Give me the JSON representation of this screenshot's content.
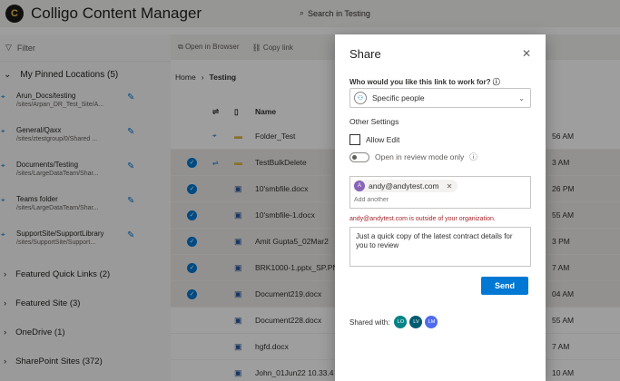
{
  "app": {
    "title": "Colligo Content Manager",
    "search": "Search in Testing"
  },
  "sidebar": {
    "filter": "Filter",
    "pinned_header": "My Pinned Locations (5)",
    "pinned": [
      {
        "title": "Arun_Docs/testing",
        "path": "/sites/Arpan_DR_Test_Site/A..."
      },
      {
        "title": "General/Qaxx",
        "path": "/sites/ztestgroup/0/Shared ..."
      },
      {
        "title": "Documents/Testing",
        "path": "/sites/LargeDataTeam/Shar..."
      },
      {
        "title": "Teams folder",
        "path": "/sites/LargeDataTeam/Shar..."
      },
      {
        "title": "SupportSite/SupportLibrary",
        "path": "/sites/SupportSite/Support..."
      }
    ],
    "groups": [
      {
        "label": "Featured Quick Links (2)"
      },
      {
        "label": "Featured Site (3)"
      },
      {
        "label": "OneDrive (1)"
      },
      {
        "label": "SharePoint Sites (372)"
      }
    ]
  },
  "toolbar": {
    "open_browser": "Open in Browser",
    "copy_link": "Copy link"
  },
  "breadcrumb": {
    "home": "Home",
    "current": "Testing"
  },
  "list": {
    "name_header": "Name",
    "rows": [
      {
        "name": "Folder_Test",
        "date": "56 AM",
        "selected": false
      },
      {
        "name": "TestBulkDelete",
        "date": "3 AM",
        "selected": true
      },
      {
        "name": "10'smbfile.docx",
        "date": "26 PM",
        "selected": true
      },
      {
        "name": "10'smbfile-1.docx",
        "date": "55 AM",
        "selected": true
      },
      {
        "name": "Amit Gupta5_02Mar2",
        "date": "3 PM",
        "selected": true
      },
      {
        "name": "BRK1000-1.pptx_SP.PN",
        "date": "7 AM",
        "selected": true
      },
      {
        "name": "Document219.docx",
        "date": "04 AM",
        "selected": true
      },
      {
        "name": "Document228.docx",
        "date": "55 AM",
        "selected": false
      },
      {
        "name": "hgfd.docx",
        "date": "7 AM",
        "selected": false
      },
      {
        "name": "John_01Jun22 10.33.4",
        "date": "10 AM",
        "selected": false
      }
    ]
  },
  "share": {
    "title": "Share",
    "question": "Who would you like this link to work for?",
    "option": "Specific people",
    "other_settings": "Other Settings",
    "allow_edit": "Allow Edit",
    "review_mode": "Open in review mode only",
    "recipient": "andy@andytest.com",
    "recipient_initial": "A",
    "add_placeholder": "Add another",
    "error": "andy@andytest.com is outside of your organization.",
    "message": "Just a quick copy of the latest contract details for you to review",
    "send": "Send",
    "shared_with": "Shared with:",
    "avatars": [
      {
        "initials": "LO",
        "color": "#038387"
      },
      {
        "initials": "LV",
        "color": "#005b70"
      },
      {
        "initials": "LM",
        "color": "#4f6bed"
      }
    ]
  }
}
